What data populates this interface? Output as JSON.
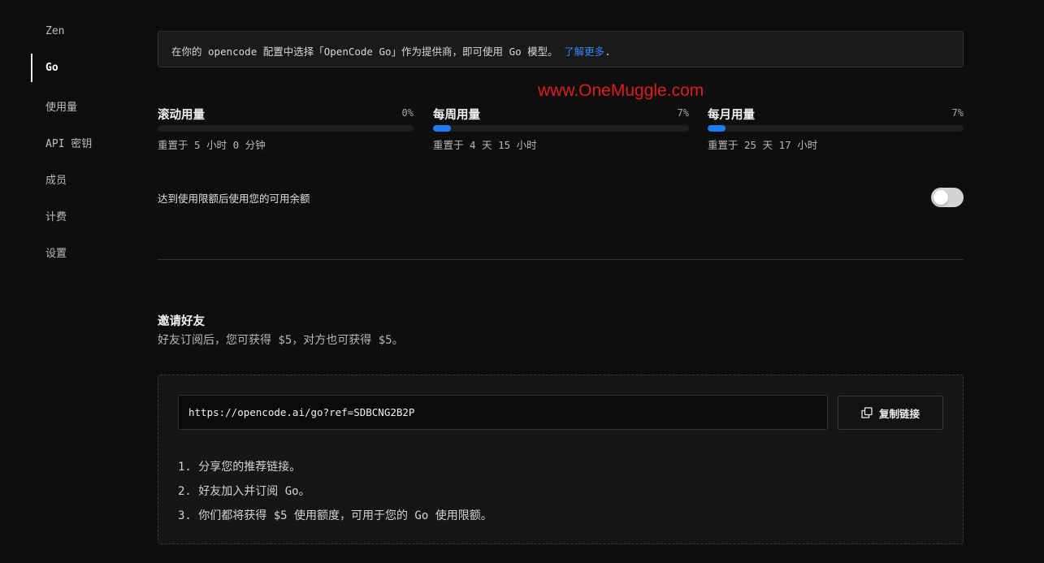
{
  "sidebar": {
    "items": [
      {
        "label": "Zen"
      },
      {
        "label": "Go",
        "active": true
      },
      {
        "label": "使用量"
      },
      {
        "label": "API 密钥"
      },
      {
        "label": "成员"
      },
      {
        "label": "计费"
      },
      {
        "label": "设置"
      }
    ]
  },
  "notice": {
    "text": "在你的 opencode 配置中选择「OpenCode Go」作为提供商，即可使用 Go 模型。 ",
    "link_label": "了解更多",
    "suffix": "."
  },
  "watermark": "www.OneMuggle.com",
  "usage": [
    {
      "title": "滚动用量",
      "percent_label": "0%",
      "fraction": 0.0,
      "reset": "重置于 5 小时 0 分钟"
    },
    {
      "title": "每周用量",
      "percent_label": "7%",
      "fraction": 0.07,
      "reset": "重置于 4 天 15 小时"
    },
    {
      "title": "每月用量",
      "percent_label": "7%",
      "fraction": 0.07,
      "reset": "重置于 25 天 17 小时"
    }
  ],
  "fallback": {
    "label": "达到使用限额后使用您的可用余额",
    "enabled": false
  },
  "invite": {
    "title": "邀请好友",
    "description": "好友订阅后，您可获得 $5，对方也可获得 $5。",
    "referral_link": "https://opencode.ai/go?ref=SDBCNG2B2P",
    "copy_label": "复制链接",
    "steps": [
      "1. 分享您的推荐链接。",
      "2. 好友加入并订阅 Go。",
      "3. 你们都将获得 $5 使用额度，可用于您的 Go 使用限额。"
    ]
  },
  "colors": {
    "accent": "#1e7cf2",
    "link": "#3b82f6",
    "watermark": "#e01b1b"
  },
  "icons": {
    "copy": "copy-icon"
  }
}
